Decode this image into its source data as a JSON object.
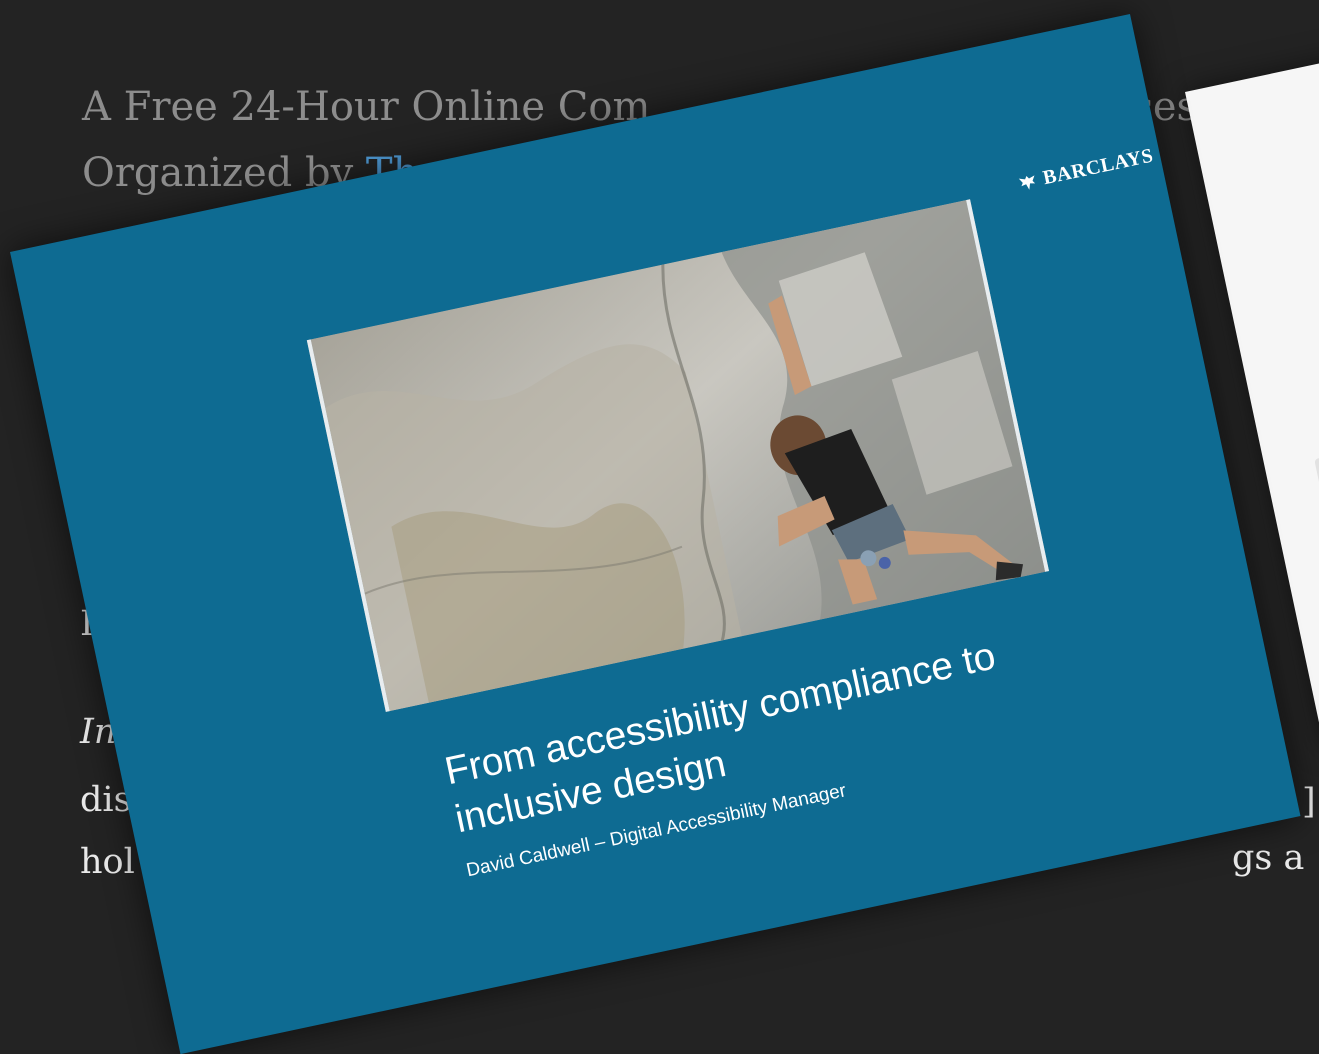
{
  "page": {
    "intro_line1": "A Free 24-Hour Online Com",
    "intro_line1_tail": "cessibil",
    "intro_line2": "Organized by ",
    "intro_link": "Th"
  },
  "body_fragments": {
    "frag1": "I",
    "frag2": "In",
    "frag3": "dis",
    "frag4": "hol",
    "frag5": "]",
    "frag6": "gs a"
  },
  "slide": {
    "brand": "BARCLAYS",
    "title": "From accessibility compliance to inclusive design",
    "subtitle": "David Caldwell – Digital Accessibility Manager"
  },
  "icons": {
    "brand_logo": "barclays-eagle-icon",
    "photo": "rock-climber-photo"
  },
  "colors": {
    "page_bg": "#232323",
    "slide_bg": "#0e6b92",
    "link": "#4f9bd6"
  }
}
